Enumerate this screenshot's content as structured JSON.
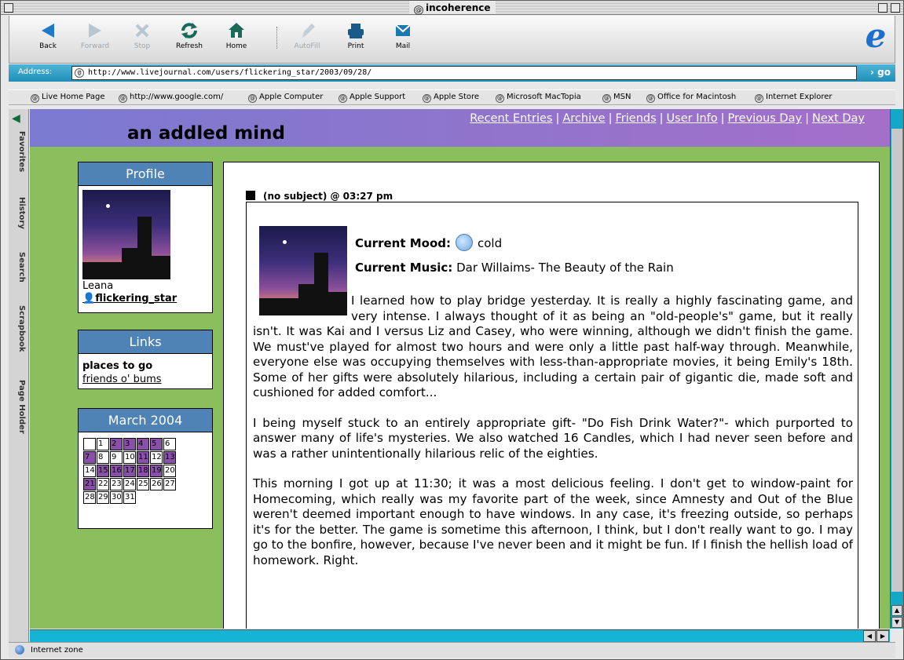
{
  "window": {
    "title": "incoherence"
  },
  "toolbar": {
    "back": "Back",
    "forward": "Forward",
    "stop": "Stop",
    "refresh": "Refresh",
    "home": "Home",
    "autofill": "AutoFill",
    "print": "Print",
    "mail": "Mail"
  },
  "address": {
    "label": "Address:",
    "url": "http://www.livejournal.com/users/flickering_star/2003/09/28/",
    "go": "go"
  },
  "favorites": [
    "Live Home Page",
    "http://www.google.com/",
    "Apple Computer",
    "Apple Support",
    "Apple Store",
    "Microsoft MacTopia",
    "MSN",
    "Office for Macintosh",
    "Internet Explorer"
  ],
  "sidetabs": [
    "Favorites",
    "History",
    "Search",
    "Scrapbook",
    "Page Holder"
  ],
  "page": {
    "title": "an addled mind",
    "nav": [
      "Recent Entries",
      "Archive",
      "Friends",
      "User Info",
      "Previous Day",
      "Next Day"
    ],
    "nav_sep": "|"
  },
  "profile": {
    "heading": "Profile",
    "name": "Leana",
    "username": "flickering_star"
  },
  "links": {
    "heading": "Links",
    "group": "places to go",
    "item": "friends o' bums"
  },
  "calendar": {
    "heading": "March 2004",
    "rows": [
      [
        "",
        "1",
        "2",
        "3",
        "4",
        "5",
        "6"
      ],
      [
        "7",
        "8",
        "9",
        "10",
        "11",
        "12",
        "13"
      ],
      [
        "14",
        "15",
        "16",
        "17",
        "18",
        "19",
        "20"
      ],
      [
        "21",
        "22",
        "23",
        "24",
        "25",
        "26",
        "27"
      ],
      [
        "28",
        "29",
        "30",
        "31"
      ]
    ],
    "highlighted": [
      "2",
      "3",
      "4",
      "5",
      "7",
      "11",
      "13",
      "15",
      "16",
      "17",
      "18",
      "19",
      "21"
    ]
  },
  "entry": {
    "subject": "(no subject) @ 03:27 pm",
    "mood_label": "Current Mood:",
    "mood": "cold",
    "music_label": "Current Music:",
    "music": "Dar Willaims- The Beauty of the Rain",
    "p1": "I learned how to play bridge yesterday. It is really a highly fascinating game, and very intense. I always thought of it as being an \"old-people's\" game, but it really isn't. It was Kai and I versus Liz and Casey, who were winning, although we didn't finish the game. We must've played for almost two hours and were only a little past half-way through. Meanwhile, everyone else was occupying themselves with less-than-appropriate movies, it being Emily's 18th. Some of her gifts were absolutely hilarious, including a certain pair of gigantic die, made soft and cushioned for added comfort...",
    "p2": "I being myself stuck to an entirely appropriate gift- \"Do Fish Drink Water?\"- which purported to answer many of life's mysteries. We also watched 16 Candles, which I had never seen before and was a rather unintentionally hilarious relic of the eighties.",
    "p3": "This morning I got up at 11:30; it was a most delicious feeling. I don't get to window-paint for Homecoming, which really was my favorite part of the week, since Amnesty and Out of the Blue weren't deemed important enough to have windows. In any case, it's freezing outside, so perhaps it's for the better. The game is sometime this afternoon, I think, but I don't really want to go. I may go to the bonfire, however, because I've never been and it might be fun. If I finish the hellish load of homework. Right."
  },
  "status": {
    "zone": "Internet zone"
  },
  "colors": {
    "page_bg": "#8bbf5e",
    "header": "#8a74cc",
    "box_head": "#4f82b5",
    "cal_highlight": "#8a4fa8"
  }
}
